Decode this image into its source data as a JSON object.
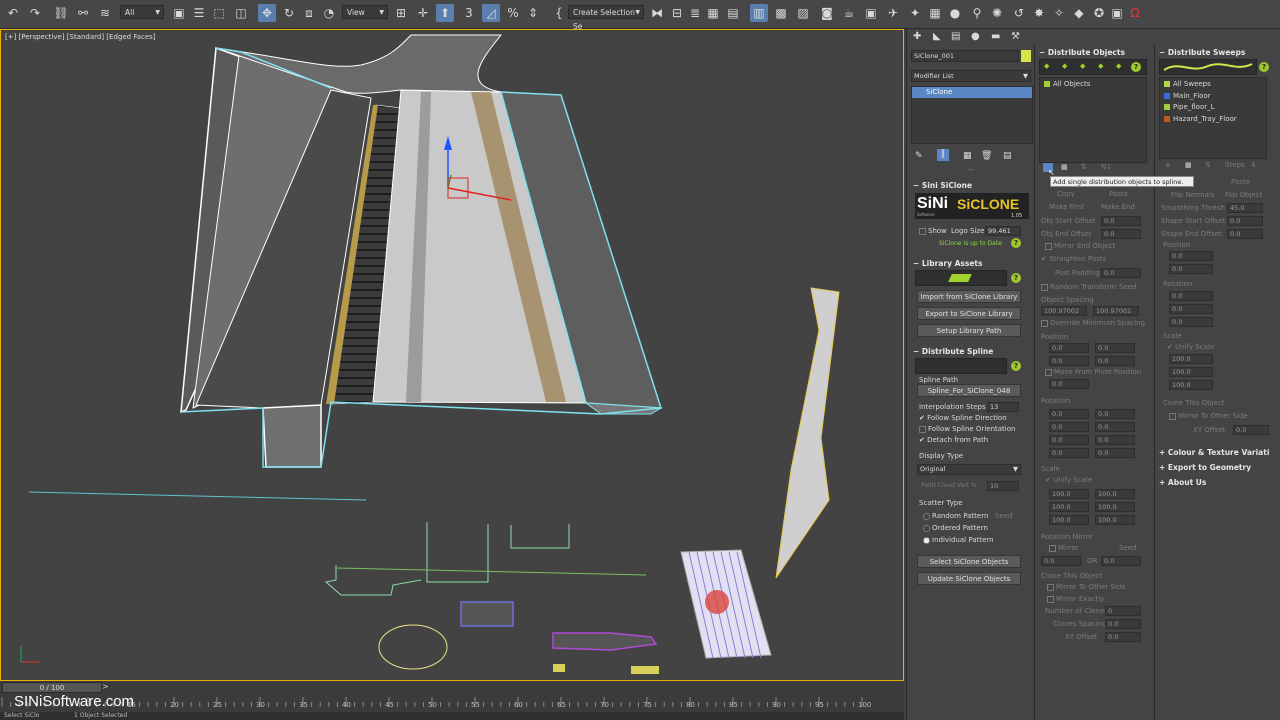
{
  "toolbar": {
    "filter_dropdown": "All",
    "view_dropdown": "View",
    "selection_set_dropdown": "Create Selection Se"
  },
  "viewport": {
    "label": "[+] [Perspective] [Standard] [Edged Faces]"
  },
  "timeline": {
    "frame_indicator": "0 / 100",
    "ticks": [
      "15",
      "20",
      "25",
      "30",
      "35",
      "40",
      "45",
      "50",
      "55",
      "60",
      "65",
      "70",
      "75",
      "80",
      "85",
      "90",
      "95",
      "100"
    ]
  },
  "watermark": "SINiSoftware.com",
  "status": {
    "left": "Select SiClo",
    "selected": "1 Object Selected"
  },
  "command_panel": {
    "object_name": "SiClone_001",
    "modifier_list_label": "Modifier List",
    "stack_item": "SiClone",
    "sini_siclone": {
      "header": "Sini SiClone",
      "logo_left": "SiNi",
      "logo_sub": "Software",
      "logo_right": "SiCLONE",
      "version": "1.05",
      "show_label": "Show",
      "logo_size_label": "Logo Size:",
      "logo_size_value": "99.461",
      "update_status": "SiClone is up to Date"
    },
    "library_assets": {
      "header": "Library Assets",
      "import_button": "Import from SiClone Library",
      "export_button": "Export to SiClone Library",
      "setup_button": "Setup Library Path"
    },
    "distribute_spline": {
      "header": "Distribute Spline",
      "spline_path_label": "Spline Path",
      "spline_path_button": "Spline_For_SiClone_048",
      "interp_label": "Interpolation Steps",
      "interp_value": "13",
      "follow_dir": "Follow Spline Direction",
      "follow_orient": "Follow Spline Orientation",
      "detach": "Detach from Path"
    },
    "display_type": {
      "header": "Display Type",
      "value": "Original",
      "point_cloud": "Point Cloud Vert %",
      "point_cloud_value": "10"
    },
    "scatter_type": {
      "header": "Scatter Type",
      "random": "Random Pattern",
      "seed": "Seed",
      "ordered": "Ordered Pattern",
      "individual": "Individual Pattern"
    },
    "select_objects_button": "Select SiClone Objects",
    "update_objects_button": "Update SiClone Objects"
  },
  "distribute_objects": {
    "header": "Distribute Objects",
    "list_item": "All Objects",
    "copy": "Copy",
    "paste": "Paste",
    "make_first": "Make First",
    "make_end": "Make End",
    "obj_start_offset": "Obj Start Offset",
    "obj_start_value": "0.0",
    "obj_end_offset": "Obj End Offset",
    "obj_end_value": "0.0",
    "mirror_end": "Mirror End Object",
    "straighten": "Straighten Posts",
    "post_padding": "Post Padding",
    "post_padding_value": "0.0",
    "random_transform": "Random Transform",
    "seed": "Seed",
    "object_spacing": "Object Spacing",
    "spacing_a": "100.97002",
    "spacing_b": "100.97002",
    "override_spacing": "Override Minimum Spacing",
    "position": "Position",
    "move_from_pivot": "Move From Pivot Position",
    "rotation": "Rotation",
    "scale": "Scale",
    "uniform_scale": "Unify Scale",
    "scale_value": "100.0",
    "rotation_mirror": "Rotation Mirror",
    "mirror": "Mirror",
    "or": "OR",
    "clone_this_object": "Clone This Object",
    "mirror_other_side": "Mirror To Other Side",
    "mirror_exactly": "Mirror Exactly",
    "number_of_clones": "Number of Clones",
    "number_value": "0",
    "clones_spacing": "Clones Spacing",
    "clones_spacing_value": "0.0",
    "xy_offset": "XY Offset",
    "xy_offset_value": "0.0",
    "zero": "0.0",
    "tooltip": "Add single distribution objects to spline."
  },
  "distribute_sweeps": {
    "header": "Distribute Sweeps",
    "items": [
      {
        "name": "All Sweeps",
        "color": "#b3d84a"
      },
      {
        "name": "Main_Floor",
        "color": "#3b6bd9"
      },
      {
        "name": "Pipe_floor_L",
        "color": "#9fce36"
      },
      {
        "name": "Hazard_Tray_Floor",
        "color": "#c05a1d"
      }
    ],
    "steps": "Steps",
    "steps_value": "4",
    "paste": "Paste",
    "flip_normals": "Flip Normals",
    "flip_object": "Flip Object",
    "smoothing_thresh": "Smoothing Thresh",
    "smoothing_value": "45.0",
    "shape_start_offset": "Shape Start Offset",
    "shape_end_offset": "Shape End Offset",
    "position": "Position",
    "rotation": "Rotation",
    "scale": "Scale",
    "uniform_scale": "Unify Scale",
    "scale_value": "100.0",
    "clone_this_object": "Clone This Object",
    "mirror_other_side": "Mirror To Other Side",
    "xy_offset": "XY Offset",
    "zero": "0.0",
    "colour_texture": "Colour & Texture Variati",
    "export_geometry": "Export to Geometry",
    "about": "About Us"
  }
}
